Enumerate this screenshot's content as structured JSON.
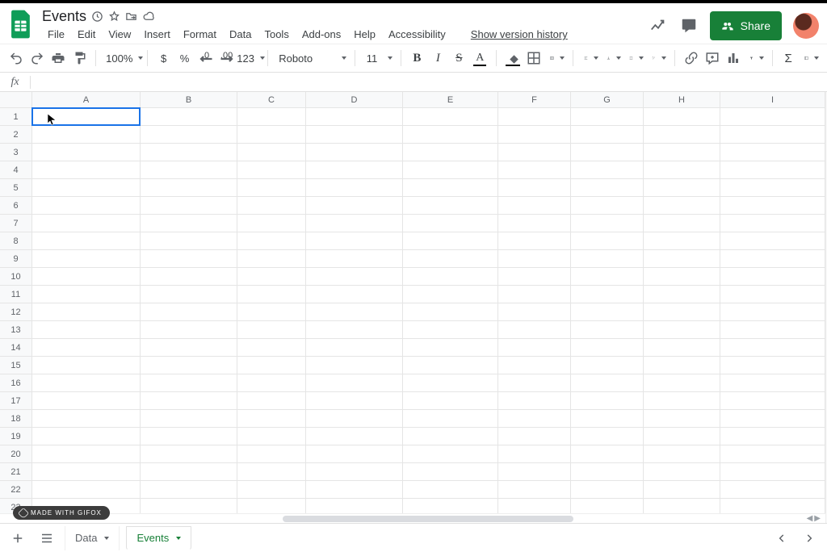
{
  "doc": {
    "title": "Events"
  },
  "menus": [
    "File",
    "Edit",
    "View",
    "Insert",
    "Format",
    "Data",
    "Tools",
    "Add-ons",
    "Help",
    "Accessibility"
  ],
  "history_link": "Show version history",
  "share_label": "Share",
  "toolbar": {
    "zoom": "100%",
    "currency": "$",
    "percent": "%",
    "dec_dec": ".0",
    "dec_inc": ".00",
    "num_format": "123",
    "font": "Roboto",
    "size": "11",
    "bold": "B",
    "italic": "I",
    "strike": "S",
    "text_color": "A",
    "sigma": "Σ"
  },
  "fx": {
    "label": "fx",
    "value": ""
  },
  "grid": {
    "columns": [
      {
        "label": "A",
        "width": 134
      },
      {
        "label": "B",
        "width": 120
      },
      {
        "label": "C",
        "width": 85
      },
      {
        "label": "D",
        "width": 120
      },
      {
        "label": "E",
        "width": 118
      },
      {
        "label": "F",
        "width": 90
      },
      {
        "label": "G",
        "width": 90
      },
      {
        "label": "H",
        "width": 95
      },
      {
        "label": "I",
        "width": 130
      }
    ],
    "rows": 23,
    "active": {
      "row": 1,
      "col": "A"
    }
  },
  "sheets": {
    "inactive": {
      "name": "Data"
    },
    "active": {
      "name": "Events"
    }
  },
  "watermark": "MADE WITH GIFOX"
}
